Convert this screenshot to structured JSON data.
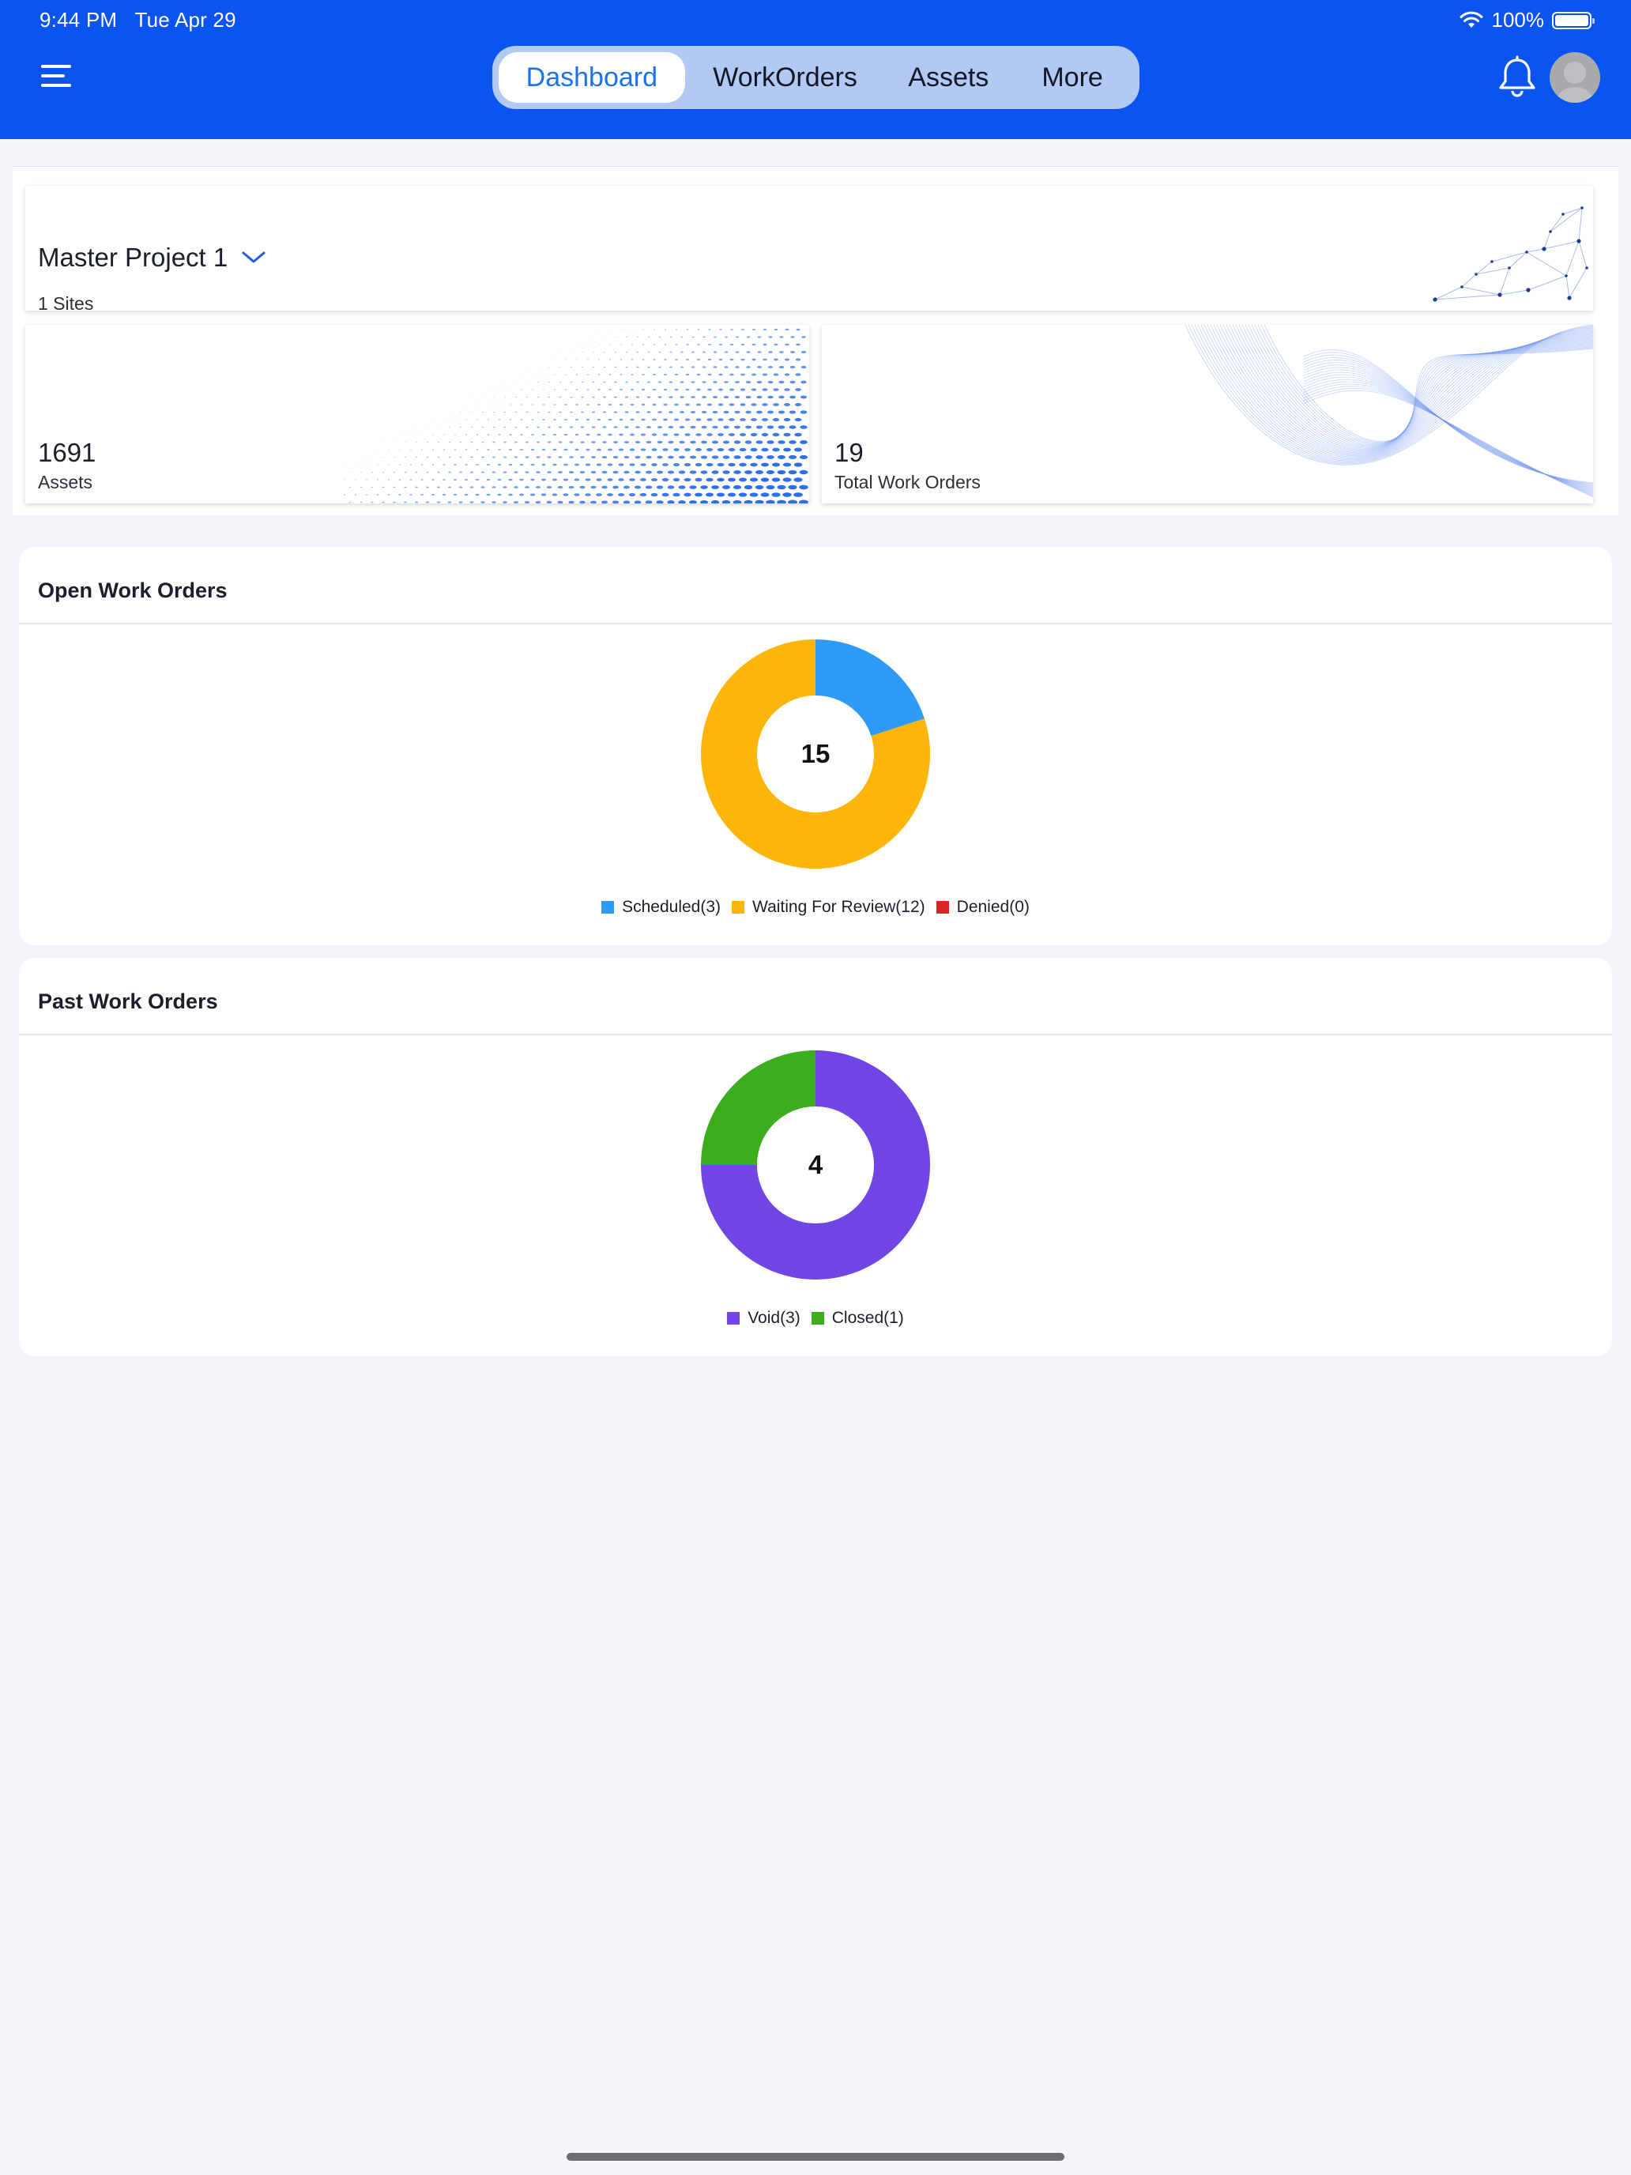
{
  "status_bar": {
    "time": "9:44 PM",
    "date": "Tue Apr 29",
    "battery": "100%"
  },
  "nav": {
    "tabs": [
      {
        "label": "Dashboard",
        "active": true
      },
      {
        "label": "WorkOrders",
        "active": false
      },
      {
        "label": "Assets",
        "active": false
      },
      {
        "label": "More",
        "active": false
      }
    ]
  },
  "project": {
    "name": "Master Project 1",
    "sites": "1 Sites"
  },
  "stats": {
    "assets": {
      "value": "1691",
      "label": "Assets"
    },
    "work_orders": {
      "value": "19",
      "label": "Total Work Orders"
    }
  },
  "open_work_orders": {
    "title": "Open Work Orders",
    "total": "15",
    "legend": [
      "Scheduled(3)",
      "Waiting For Review(12)",
      "Denied(0)"
    ]
  },
  "past_work_orders": {
    "title": "Past Work Orders",
    "total": "4",
    "legend": [
      "Void(3)",
      "Closed(1)"
    ]
  },
  "colors": {
    "brand": "#0b54ef",
    "scheduled": "#2e9bf7",
    "waiting": "#fdb509",
    "denied": "#dc2626",
    "void": "#7045e3",
    "closed": "#3cad1c"
  },
  "chart_data": [
    {
      "type": "pie",
      "title": "Open Work Orders",
      "categories": [
        "Scheduled",
        "Waiting For Review",
        "Denied"
      ],
      "values": [
        3,
        12,
        0
      ],
      "total": 15,
      "colors": [
        "#2e9bf7",
        "#fdb509",
        "#dc2626"
      ],
      "legend": "bottom"
    },
    {
      "type": "pie",
      "title": "Past Work Orders",
      "categories": [
        "Void",
        "Closed"
      ],
      "values": [
        3,
        1
      ],
      "total": 4,
      "colors": [
        "#7045e3",
        "#3cad1c"
      ],
      "legend": "bottom"
    }
  ]
}
